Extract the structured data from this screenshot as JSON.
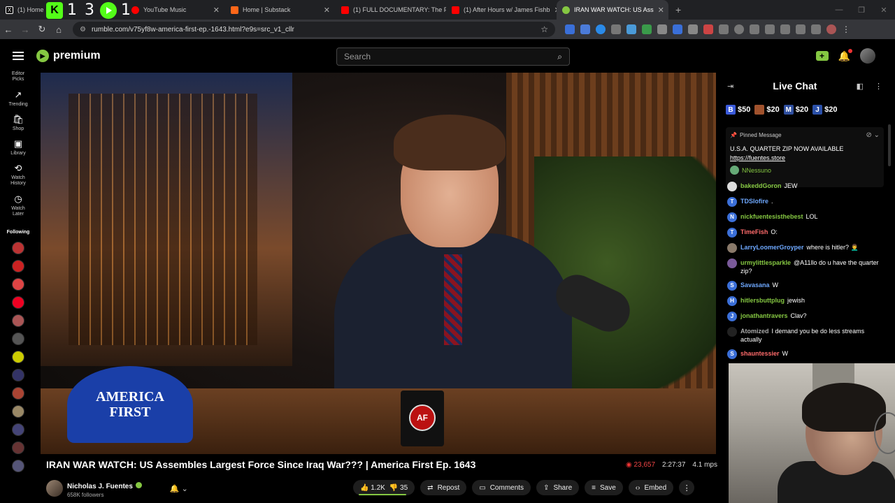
{
  "browser": {
    "tabs": [
      {
        "label": "(1) Home",
        "icon": "x-icon",
        "color": "#ffffff"
      },
      {
        "label": "YouTube Music",
        "icon": "youtube-music-icon",
        "color": "#ff0000"
      },
      {
        "label": "Home | Substack",
        "icon": "substack-icon",
        "color": "#ff6719"
      },
      {
        "label": "(1) FULL DOCUMENTARY: The F",
        "icon": "youtube-icon",
        "color": "#ff0000"
      },
      {
        "label": "(1) After Hours w/ James Fishb",
        "icon": "youtube-icon",
        "color": "#ff0000"
      },
      {
        "label": "IRAN WAR WATCH: US Ass",
        "icon": "rumble-icon",
        "color": "#85c742",
        "active": true
      }
    ],
    "overlay": {
      "k_label": "K",
      "count": "1 3",
      "play_count": "1"
    },
    "url": "rumble.com/v75yf8w-america-first-ep.-1643.html?e9s=src_v1_cllr"
  },
  "header": {
    "brand": "premium",
    "search_placeholder": "Search"
  },
  "sidebar": {
    "items": [
      {
        "label": "Editor Picks",
        "icon": "editor-picks-icon",
        "glyph": ""
      },
      {
        "label": "Trending",
        "icon": "trending-icon",
        "glyph": "↗"
      },
      {
        "label": "Shop",
        "icon": "shop-icon",
        "glyph": "🛍"
      },
      {
        "label": "Library",
        "icon": "library-icon",
        "glyph": "▣"
      },
      {
        "label": "Watch History",
        "icon": "history-icon",
        "glyph": "⟲"
      },
      {
        "label": "Watch Later",
        "icon": "clock-icon",
        "glyph": "◷"
      }
    ],
    "following_label": "Following",
    "following_colors": [
      "#b33",
      "#c22",
      "#d44",
      "#e02",
      "#a55",
      "#555",
      "#cc0",
      "#336",
      "#a43",
      "#986",
      "#447",
      "#633",
      "#557"
    ]
  },
  "video": {
    "hat_text_1": "AMERICA",
    "hat_text_2": "FIRST",
    "mug_text": "AF",
    "title": "IRAN WAR WATCH: US Assembles Largest Force Since Iraq War??? | America First Ep. 1643",
    "viewers": "23,657",
    "duration": "2:27:37",
    "bitrate": "4.1 mps"
  },
  "channel": {
    "name": "Nicholas J. Fuentes",
    "followers": "658K followers"
  },
  "actions": {
    "likes": "1.2K",
    "like_fraction": 0.97,
    "dislikes": "35",
    "repost": "Repost",
    "comments": "Comments",
    "share": "Share",
    "save": "Save",
    "embed": "Embed"
  },
  "chat": {
    "title": "Live Chat",
    "rants": [
      {
        "letter": "B",
        "amount": "$50",
        "color": "#3b5bdb"
      },
      {
        "letter": "",
        "amount": "$20",
        "color": "#a0522d"
      },
      {
        "letter": "M",
        "amount": "$20",
        "color": "#2f4f9f"
      },
      {
        "letter": "J",
        "amount": "$20",
        "color": "#2b50a8"
      }
    ],
    "pinned_label": "Pinned Message",
    "pinned_text": "U.S.A. QUARTER ZIP NOW AVAILABLE ",
    "pinned_link": "https://fuentes.store",
    "pinned_author": "NNessuno",
    "messages": [
      {
        "initial": "",
        "user": "bakeddGoron",
        "text": "JEW",
        "user_color": "#85c742",
        "av_color": "#ddd"
      },
      {
        "initial": "T",
        "user": "TDSlofire",
        "text": ".",
        "user_color": "#6ea8fe",
        "av_color": "#3b6fd8"
      },
      {
        "initial": "N",
        "user": "nickfuentesisthebest",
        "text": "LOL",
        "user_color": "#85c742",
        "av_color": "#3b6fd8"
      },
      {
        "initial": "T",
        "user": "TimeFish",
        "text": "O:",
        "user_color": "#ff6b6b",
        "av_color": "#3b6fd8"
      },
      {
        "initial": "",
        "user": "LarryLoomerGroyper",
        "text": "where is hitler? 👨‍🦱",
        "user_color": "#6ea8fe",
        "av_color": "#8a7a6a"
      },
      {
        "initial": "",
        "user": "urmylittlesparkle",
        "text": "@A11llo do u have the quarter zip?",
        "user_color": "#85c742",
        "av_color": "#7a5a9a"
      },
      {
        "initial": "S",
        "user": "Savasana",
        "text": "W",
        "user_color": "#6ea8fe",
        "av_color": "#3b6fd8"
      },
      {
        "initial": "H",
        "user": "hitlersbuttplug",
        "text": "jewish",
        "user_color": "#85c742",
        "av_color": "#3b6fd8"
      },
      {
        "initial": "J",
        "user": "jonathantravers",
        "text": "Clav?",
        "user_color": "#85c742",
        "av_color": "#3b6fd8"
      },
      {
        "initial": "",
        "user": "Atomized",
        "text": "I demand you be do less streams actually",
        "user_color": "#aaaaaa",
        "av_color": "#222"
      },
      {
        "initial": "S",
        "user": "shauntessier",
        "text": "W",
        "user_color": "#ff6b6b",
        "av_color": "#3b6fd8"
      }
    ]
  }
}
